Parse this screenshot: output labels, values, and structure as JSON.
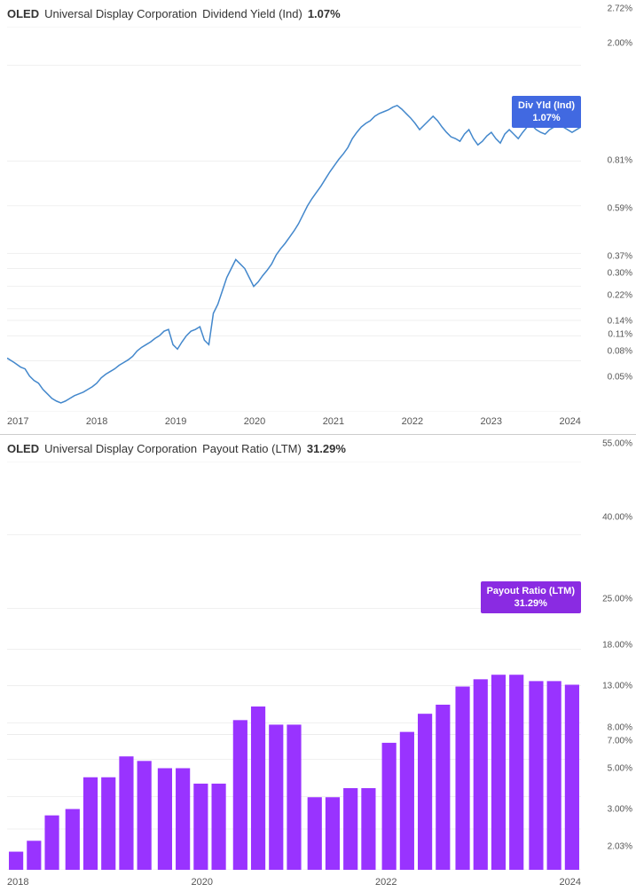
{
  "top_chart": {
    "ticker": "OLED",
    "company": "Universal Display Corporation",
    "metric": "Dividend Yield (Ind)",
    "value": "1.07%",
    "tooltip_label": "Div Yld (Ind)",
    "tooltip_value": "1.07%",
    "y_axis": [
      {
        "label": "2.72%",
        "pct": 0
      },
      {
        "label": "2.00%",
        "pct": 8
      },
      {
        "label": "0.81%",
        "pct": 35
      },
      {
        "label": "0.59%",
        "pct": 47
      },
      {
        "label": "0.37%",
        "pct": 59
      },
      {
        "label": "0.30%",
        "pct": 63
      },
      {
        "label": "0.22%",
        "pct": 68
      },
      {
        "label": "0.14%",
        "pct": 74
      },
      {
        "label": "0.11%",
        "pct": 76
      },
      {
        "label": "0.08%",
        "pct": 79
      },
      {
        "label": "0.05%",
        "pct": 85
      }
    ]
  },
  "bottom_chart": {
    "ticker": "OLED",
    "company": "Universal Display Corporation",
    "metric": "Payout Ratio (LTM)",
    "value": "31.29%",
    "tooltip_label": "Payout Ratio (LTM)",
    "tooltip_value": "31.29%",
    "y_axis": [
      {
        "label": "55.00%",
        "pct": 0
      },
      {
        "label": "40.00%",
        "pct": 18
      },
      {
        "label": "25.00%",
        "pct": 36
      },
      {
        "label": "18.00%",
        "pct": 45
      },
      {
        "label": "13.00%",
        "pct": 54
      },
      {
        "label": "8.00%",
        "pct": 63
      },
      {
        "label": "7.00%",
        "pct": 65
      },
      {
        "label": "5.00%",
        "pct": 72
      },
      {
        "label": "3.00%",
        "pct": 82
      },
      {
        "label": "2.03%",
        "pct": 90
      }
    ],
    "x_axis": [
      "2018",
      "2020",
      "2022",
      "2024"
    ]
  }
}
